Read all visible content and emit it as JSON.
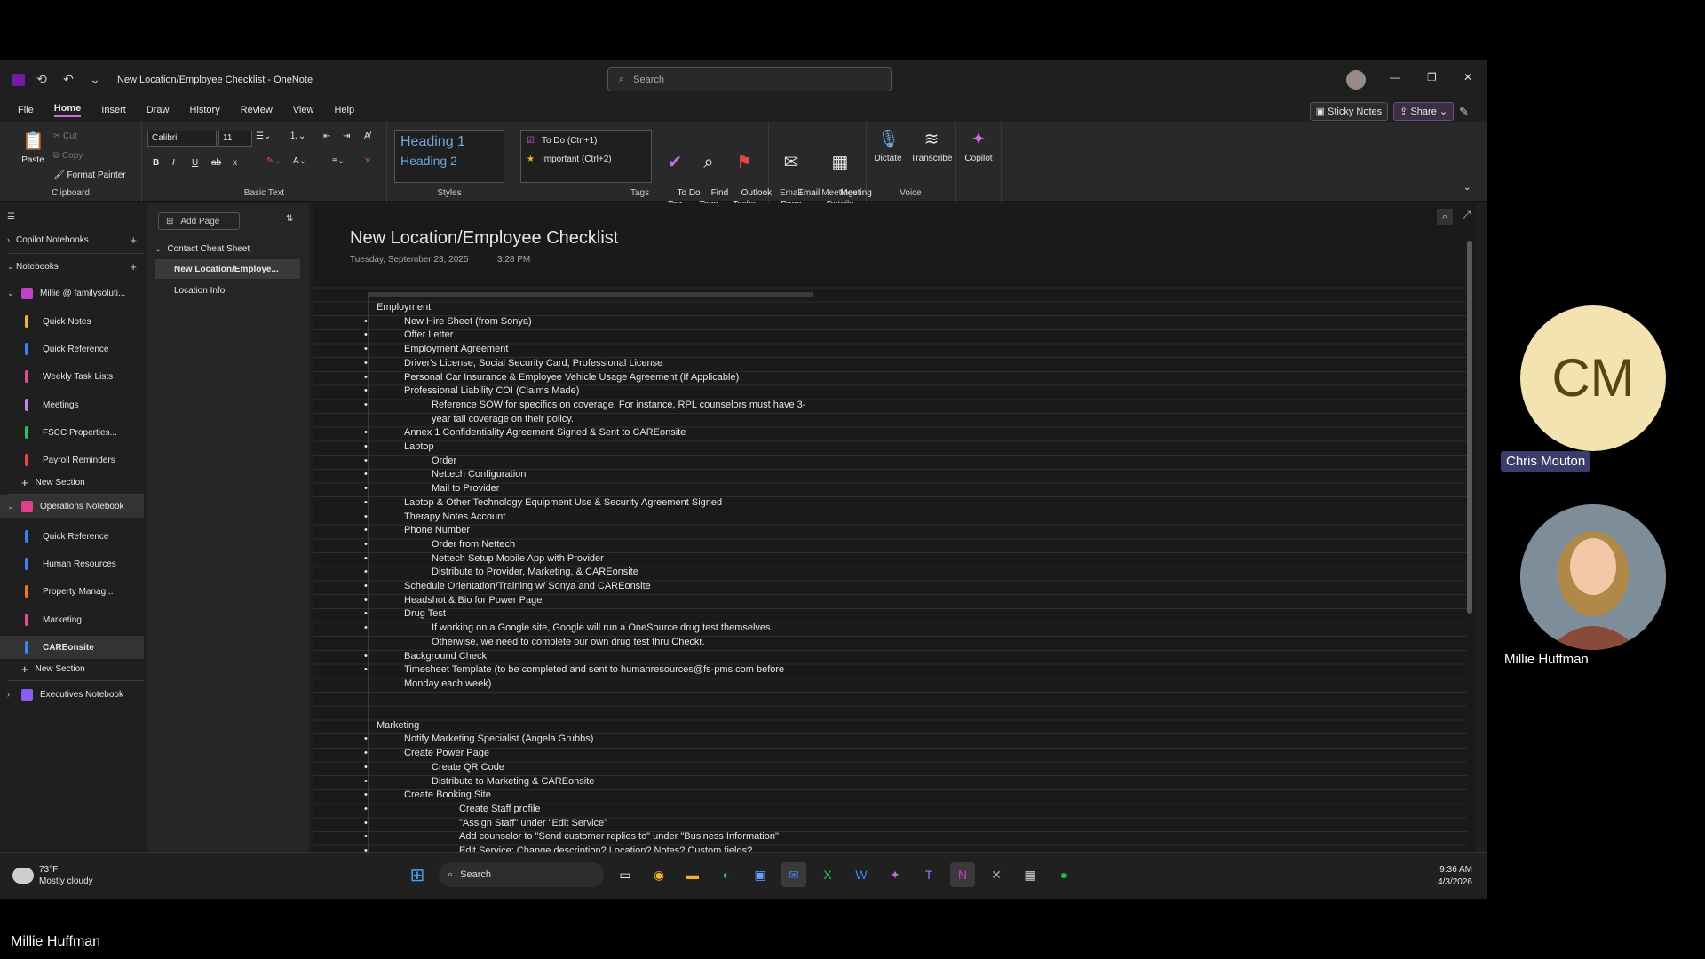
{
  "window": {
    "title": "New Location/Employee Checklist  -  OneNote",
    "search_placeholder": "Search"
  },
  "menu": {
    "items": [
      "File",
      "Home",
      "Insert",
      "Draw",
      "History",
      "Review",
      "View",
      "Help"
    ],
    "active": "Home",
    "sticky_notes": "Sticky Notes",
    "share": "Share"
  },
  "ribbon": {
    "clipboard": {
      "paste": "Paste",
      "cut": "Cut",
      "copy": "Copy",
      "format_painter": "Format Painter",
      "label": "Clipboard"
    },
    "basic_text": {
      "font": "Calibri",
      "size": "11",
      "bold": "B",
      "italic": "I",
      "underline": "U",
      "strike": "ab",
      "sub": "x",
      "label": "Basic Text"
    },
    "styles": {
      "heading1": "Heading 1",
      "heading2": "Heading 2",
      "label": "Styles"
    },
    "tags": {
      "todo": "To Do (Ctrl+1)",
      "important": "Important (Ctrl+2)",
      "todo_tag": "To Do\nTag",
      "find_tags": "Find\nTags",
      "outlook_tasks": "Outlook\nTasks",
      "label": "Tags"
    },
    "email": {
      "email_page": "Email\nPage",
      "label": "Email"
    },
    "meetings": {
      "meeting_details": "Meeting\nDetails",
      "label": "Meetings"
    },
    "voice": {
      "dictate": "Dictate",
      "transcribe": "Transcribe",
      "label": "Voice"
    },
    "copilot": {
      "label": "Copilot"
    }
  },
  "sidebar": {
    "copilot_notebooks": "Copilot Notebooks",
    "notebooks": "Notebooks",
    "notebook1": {
      "name": "Millie @ familysoluti...",
      "sections": [
        "Quick Notes",
        "Quick Reference",
        "Weekly Task Lists",
        "Meetings",
        "FSCC Properties...",
        "Payroll Reminders"
      ],
      "colors": [
        "#f0b429",
        "#3b82f6",
        "#ec4899",
        "#c084fc",
        "#22c55e",
        "#ef4444"
      ],
      "new_section": "New Section"
    },
    "notebook2": {
      "name": "Operations Notebook",
      "sections": [
        "Quick Reference",
        "Human Resources",
        "Property Manag...",
        "Marketing",
        "CAREonsite"
      ],
      "colors": [
        "#3b82f6",
        "#3b82f6",
        "#f97316",
        "#ec4899",
        "#3b82f6"
      ],
      "selected": "CAREonsite",
      "new_section": "New Section"
    },
    "executives": "Executives Notebook"
  },
  "pages": {
    "add_page": "Add Page",
    "group": "Contact Cheat Sheet",
    "items": [
      "New Location/Employe...",
      "Location Info"
    ],
    "selected": "New Location/Employe..."
  },
  "page": {
    "title": "New Location/Employee Checklist",
    "date": "Tuesday, September 23, 2025",
    "time": "3:28 PM"
  },
  "note": {
    "employment_heading": "Employment",
    "e1": "New Hire Sheet (from Sonya)",
    "e2": "Offer Letter",
    "e3": "Employment Agreement",
    "e4": "Driver's License, Social Security Card, Professional License",
    "e5": "Personal Car Insurance & Employee Vehicle Usage Agreement (If Applicable)",
    "e6": "Professional Liability COI (Claims Made)",
    "e6a": "Reference SOW for specifics on coverage. For instance, RPL counselors must have 3-year tail coverage on their policy.",
    "e7": "Annex 1 Confidentiality Agreement Signed & Sent to CAREonsite",
    "e8": "Laptop",
    "e8a": "Order",
    "e8b": "Nettech Configuration",
    "e8c": "Mail to Provider",
    "e9": "Laptop & Other Technology Equipment Use & Security Agreement Signed",
    "e10": "Therapy Notes Account",
    "e11": "Phone Number",
    "e11a": "Order from Nettech",
    "e11b": "Nettech Setup Mobile App with Provider",
    "e11c": "Distribute to Provider, Marketing, & CAREonsite",
    "e12": "Schedule Orientation/Training w/ Sonya and CAREonsite",
    "e13": "Headshot & Bio for Power Page",
    "e14": "Drug Test",
    "e14a": "If working on a Google site, Google will run a OneSource drug test themselves. Otherwise, we need to complete our own drug test thru Checkr.",
    "e15": "Background Check",
    "e16": "Timesheet Template (to be completed and sent to humanresources@fs-pms.com before Monday each week)",
    "marketing_heading": "Marketing",
    "m1": "Notify Marketing Specialist (Angela Grubbs)",
    "m2": "Create Power Page",
    "m2a": "Create QR Code",
    "m2b": "Distribute to Marketing & CAREonsite",
    "m3": "Create Booking Site",
    "m3a": "Create Staff profile",
    "m3b": "\"Assign Staff\" under \"Edit Service\"",
    "m3c": "Add counselor to \"Send customer replies to\" under \"Business Information\"",
    "m3d": "Edit Service: Change description? Location? Notes? Custom fields?"
  },
  "taskbar": {
    "temp": "73°F",
    "weather": "Mostly cloudy",
    "search": "Search",
    "time": "9:36 AM",
    "date": "4/3/2026"
  },
  "participants": {
    "cm_initials": "CM",
    "cm_name": "Chris Mouton",
    "mh_name": "Millie Huffman",
    "bottom_name": "Millie Huffman"
  }
}
